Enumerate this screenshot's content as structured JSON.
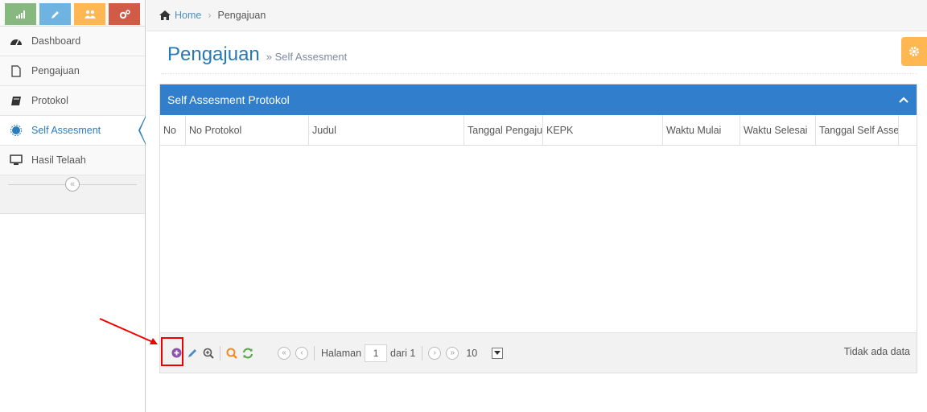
{
  "sidebar": {
    "shortcuts": [
      {
        "icon": "signal-icon",
        "color": "#87b87f"
      },
      {
        "icon": "pencil-icon",
        "color": "#6fb3e0"
      },
      {
        "icon": "users-icon",
        "color": "#ffb752"
      },
      {
        "icon": "cogs-icon",
        "color": "#d15b47"
      }
    ],
    "items": [
      {
        "label": "Dashboard",
        "icon": "tachometer-icon"
      },
      {
        "label": "Pengajuan",
        "icon": "file-icon"
      },
      {
        "label": "Protokol",
        "icon": "book-icon"
      },
      {
        "label": "Self Assesment",
        "icon": "certificate-icon",
        "active": true
      },
      {
        "label": "Hasil Telaah",
        "icon": "desktop-icon"
      }
    ],
    "collapse_symbol": "«"
  },
  "breadcrumb": {
    "home": "Home",
    "current": "Pengajuan"
  },
  "page": {
    "title": "Pengajuan",
    "subtitle": "» Self Assesment"
  },
  "grid": {
    "caption": "Self Assesment Protokol",
    "columns": [
      "No",
      "No Protokol",
      "Judul",
      "Tanggal Pengajuan",
      "KEPK",
      "Waktu Mulai",
      "Waktu Selesai",
      "Tanggal Self Assesment"
    ],
    "rows": []
  },
  "pager": {
    "page_label": "Halaman",
    "current_page": "1",
    "of_label": "dari 1",
    "rows_per_page": "10",
    "info": "Tidak ada data"
  },
  "colors": {
    "accent": "#307ecc",
    "title": "#2679b5",
    "highlight": "#e00000"
  }
}
